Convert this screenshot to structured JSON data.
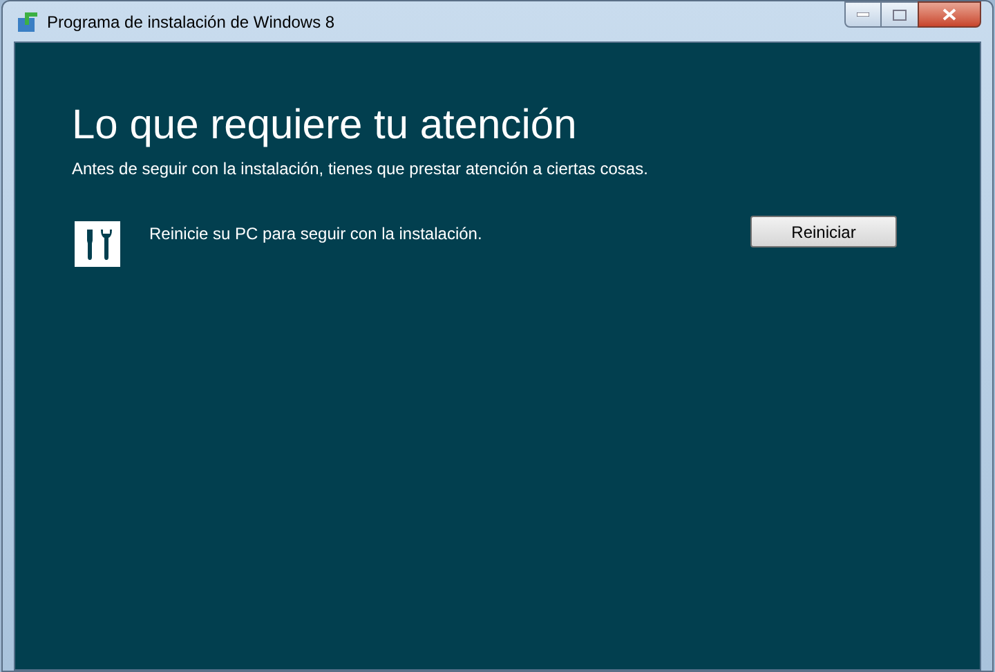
{
  "window": {
    "title": "Programa de instalación de Windows 8"
  },
  "heading": "Lo que requiere tu atención",
  "subtitle": "Antes de seguir con la instalación, tienes que prestar atención a ciertas cosas.",
  "items": [
    {
      "text": "Reinicie su PC para seguir con la instalación.",
      "button": "Reiniciar"
    }
  ]
}
